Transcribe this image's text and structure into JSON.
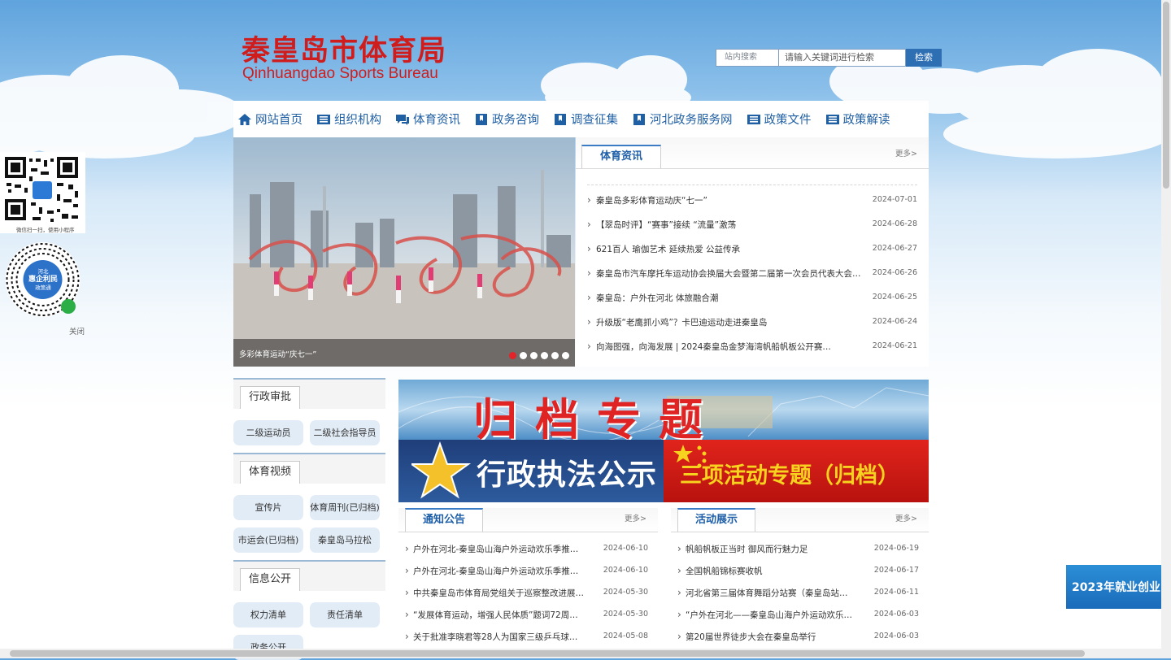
{
  "header": {
    "title_cn": "秦皇岛市体育局",
    "title_en": "Qinhuangdao Sports Bureau"
  },
  "search": {
    "label": "站内搜索",
    "placeholder": "请输入关键词进行检索",
    "button": "检索"
  },
  "nav": [
    {
      "label": "网站首页",
      "icon": "home-icon"
    },
    {
      "label": "组织机构",
      "icon": "book-icon"
    },
    {
      "label": "体育资讯",
      "icon": "chat-icon"
    },
    {
      "label": "政务咨询",
      "icon": "bookmark-icon"
    },
    {
      "label": "调查征集",
      "icon": "bookmark-icon"
    },
    {
      "label": "河北政务服务网",
      "icon": "bookmark-icon"
    },
    {
      "label": "政策文件",
      "icon": "book-icon"
    },
    {
      "label": "政策解读",
      "icon": "book-icon"
    }
  ],
  "slider": {
    "caption": "多彩体育运动“庆七一”",
    "dot_count": 6,
    "active_dot": 1
  },
  "news": {
    "tab": "体育资讯",
    "more": "更多>",
    "items": [
      {
        "title": "秦皇岛多彩体育运动庆“七一”",
        "date": "2024-07-01"
      },
      {
        "title": "【翠岛时评】“赛事”接续 “流量”激荡",
        "date": "2024-06-28"
      },
      {
        "title": "621百人 瑜伽艺术 延续热爱 公益传承",
        "date": "2024-06-27"
      },
      {
        "title": "秦皇岛市汽车摩托车运动协会换届大会暨第二届第一次会员代表大会…",
        "date": "2024-06-26"
      },
      {
        "title": "秦皇岛：户外在河北 体旅融合潮",
        "date": "2024-06-25"
      },
      {
        "title": "升级版“老鹰抓小鸡”？卡巴迪运动走进秦皇岛",
        "date": "2024-06-24"
      },
      {
        "title": "向海图强，向海发展 | 2024秦皇岛金梦海湾帆船帆板公开赛…",
        "date": "2024-06-21"
      }
    ]
  },
  "left": {
    "sections": [
      {
        "title": "行政审批",
        "buttons": [
          "二级运动员",
          "二级社会指导员"
        ]
      },
      {
        "title": "体育视频",
        "buttons": [
          "宣传片",
          "体育周刊(已归档)",
          "市运会(已归档)",
          "秦皇岛马拉松"
        ]
      },
      {
        "title": "信息公开",
        "buttons": [
          "权力清单",
          "责任清单",
          "政务公开"
        ]
      }
    ]
  },
  "banners": {
    "archive": "归档专题",
    "enforcement": "行政执法公示",
    "activities": "三项活动专题（归档）"
  },
  "notice": {
    "tab": "通知公告",
    "more": "更多>",
    "items": [
      {
        "title": "户外在河北-秦皇岛山海户外运动欢乐季推进方…",
        "date": "2024-06-10"
      },
      {
        "title": "户外在河北-秦皇岛山海户外运动欢乐季推进方…",
        "date": "2024-06-10"
      },
      {
        "title": "中共秦皇岛市体育局党组关于巡察整改进展情…",
        "date": "2024-05-30"
      },
      {
        "title": "“发展体育运动，增强人民体质”题词72周…",
        "date": "2024-05-30"
      },
      {
        "title": "关于批准李晓君等28人为国家三级乒乓球裁…",
        "date": "2024-05-08"
      }
    ]
  },
  "activity": {
    "tab": "活动展示",
    "more": "更多>",
    "items": [
      {
        "title": "帆船帆板正当时 御风而行魅力足",
        "date": "2024-06-19"
      },
      {
        "title": "全国帆船锦标赛收帆",
        "date": "2024-06-17"
      },
      {
        "title": "河北省第三届体育舞蹈分站赛（秦皇岛站）激…",
        "date": "2024-06-11"
      },
      {
        "title": "“户外在河北——秦皇岛山海户外运动欢乐季”…",
        "date": "2024-06-03"
      },
      {
        "title": "第20届世界徒步大会在秦皇岛举行",
        "date": "2024-06-03"
      }
    ]
  },
  "floating": {
    "qr1_caption": "微信扫一扫，使用小程序",
    "qr2_badge": [
      "河北",
      "惠企利民",
      "政策通"
    ],
    "close": "关闭",
    "ad": "2023年就业创业"
  }
}
